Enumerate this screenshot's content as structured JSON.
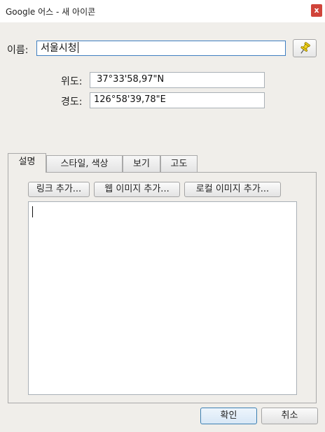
{
  "window": {
    "title": "Google 어스 - 새 아이콘",
    "close_label": "x"
  },
  "name": {
    "label": "이름:",
    "value": "서울시청"
  },
  "coords": {
    "lat_label": "위도:",
    "lat_value": " 37°33'58,97\"N",
    "lon_label": "경도:",
    "lon_value": "126°58'39,78\"E"
  },
  "tabs": [
    {
      "label": "설명"
    },
    {
      "label": "스타일, 색상"
    },
    {
      "label": "보기"
    },
    {
      "label": "고도"
    }
  ],
  "description": {
    "add_link_label": "링크 추가...",
    "add_web_image_label": "웹 이미지 추가...",
    "add_local_image_label": "로컬 이미지 추가...",
    "text": ""
  },
  "footer": {
    "ok_label": "확인",
    "cancel_label": "취소"
  },
  "icons": {
    "pin": "pushpin-icon"
  },
  "colors": {
    "pin_yellow": "#f2d41b",
    "close_red": "#d0443a",
    "focus_blue": "#3f7fc1"
  }
}
